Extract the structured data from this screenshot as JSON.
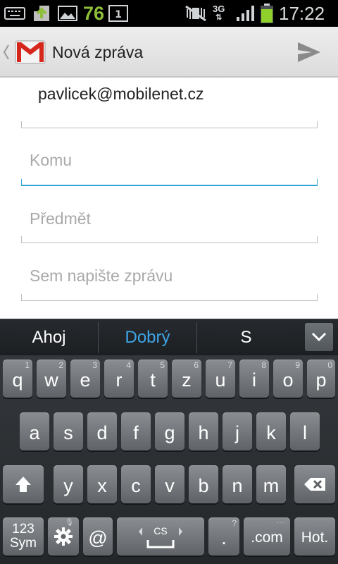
{
  "status_bar": {
    "notification_count": "76",
    "network": "3G",
    "time": "17:22"
  },
  "action_bar": {
    "title": "Nová zpráva"
  },
  "compose": {
    "from": "pavlicek@mobilenet.cz",
    "to_placeholder": "Komu",
    "subject_placeholder": "Předmět",
    "body_placeholder": "Sem napište zprávu"
  },
  "keyboard": {
    "suggestions": [
      "Ahoj",
      "Dobrý",
      "S"
    ],
    "row1": [
      {
        "key": "q",
        "hint": "1"
      },
      {
        "key": "w",
        "hint": "2"
      },
      {
        "key": "e",
        "hint": "3"
      },
      {
        "key": "r",
        "hint": "4"
      },
      {
        "key": "t",
        "hint": "5"
      },
      {
        "key": "z",
        "hint": "6"
      },
      {
        "key": "u",
        "hint": "7"
      },
      {
        "key": "i",
        "hint": "8"
      },
      {
        "key": "o",
        "hint": "9"
      },
      {
        "key": "p",
        "hint": "0"
      }
    ],
    "row2": [
      "a",
      "s",
      "d",
      "f",
      "g",
      "h",
      "j",
      "k",
      "l"
    ],
    "row3": [
      "y",
      "x",
      "c",
      "v",
      "b",
      "n",
      "m"
    ],
    "sym_label_top": "123",
    "sym_label_bottom": "Sym",
    "at_label": "@",
    "space_lang": "CS",
    "period_label": ".",
    "period_hint": "?",
    "dotcom_label": ".com",
    "hot_label": "Hot."
  },
  "colors": {
    "accent": "#33a3d4",
    "suggestion_primary": "#3fa6e8"
  }
}
